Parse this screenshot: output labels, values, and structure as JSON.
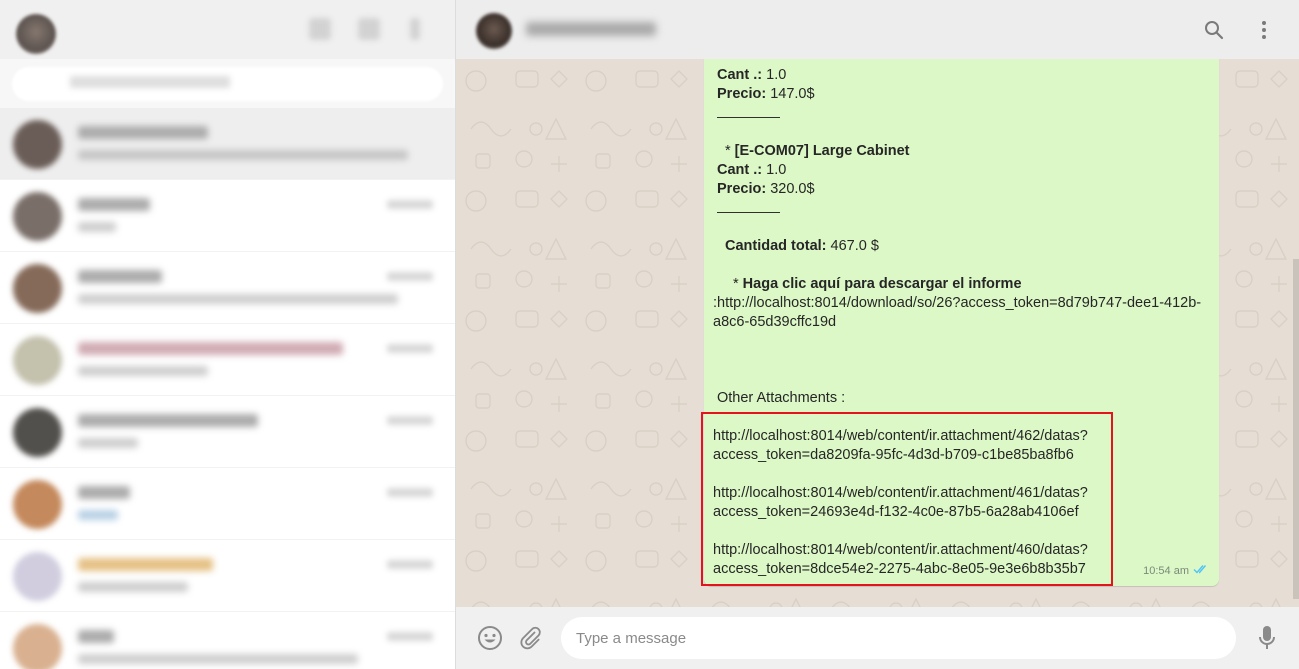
{
  "conversation": {
    "message": {
      "item1": {
        "cant_label": "Cant .:",
        "cant_value": " 1.0",
        "precio_label": "Precio:",
        "precio_value": " 147.0$"
      },
      "item2": {
        "bullet": "* ",
        "title": "[E-COM07] Large Cabinet",
        "cant_label": "Cant .:",
        "cant_value": " 1.0",
        "precio_label": "Precio:",
        "precio_value": " 320.0$"
      },
      "total": {
        "label": "Cantidad total:",
        "value": " 467.0 $"
      },
      "download": {
        "bullet": "* ",
        "label": "Haga clic aquí para descargar el informe",
        "link_line1": ":http://localhost:8014/download/so/26?access_token=8d79b747-dee1-412b-",
        "link_line2": "a8c6-65d39cffc19d"
      },
      "other_attachments_label": "Other Attachments :",
      "attachments": [
        {
          "line1": "http://localhost:8014/web/content/ir.attachment/462/datas?",
          "line2": "access_token=da8209fa-95fc-4d3d-b709-c1be85ba8fb6"
        },
        {
          "line1": "http://localhost:8014/web/content/ir.attachment/461/datas?",
          "line2": "access_token=24693e4d-f132-4c0e-87b5-6a28ab4106ef"
        },
        {
          "line1": "http://localhost:8014/web/content/ir.attachment/460/datas?",
          "line2": "access_token=8dce54e2-2275-4abc-8e05-9e3e6b8b35b7"
        }
      ],
      "time": "10:54 am",
      "status_icon": "double-check-icon"
    }
  },
  "composer": {
    "placeholder": "Type a message"
  },
  "colors": {
    "bubble": "#dcf8c6",
    "highlight": "#e3141b",
    "read_ticks": "#4fc3f7"
  }
}
